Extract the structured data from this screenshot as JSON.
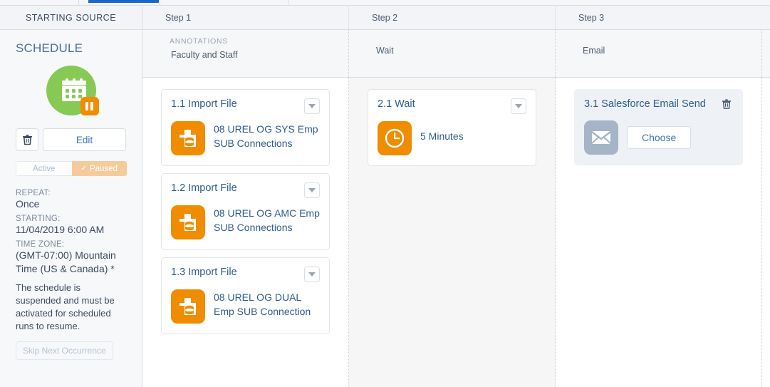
{
  "tabs": {
    "active_tab_indicator": "active"
  },
  "sidebar": {
    "header_title": "STARTING SOURCE",
    "schedule_title": "SCHEDULE",
    "icon": {
      "name": "calendar-icon",
      "badge": "pause-badge",
      "circle_color": "#86ca55",
      "badge_color": "#ef8c00"
    },
    "delete_label": "delete",
    "edit_label": "Edit",
    "toggle": {
      "inactive_label": "Active",
      "active_label": "Paused",
      "check": "✓",
      "active_color": "#f6cb9c"
    },
    "meta": [
      {
        "label": "REPEAT:",
        "value": "Once"
      },
      {
        "label": "STARTING:",
        "value": "11/04/2019 6:00 AM"
      },
      {
        "label": "TIME ZONE:",
        "value": "(GMT-07:00) Mountain Time (US & Canada) *"
      }
    ],
    "notice": "The schedule is suspended and must be activated for scheduled runs to resume.",
    "skip_label": "Skip Next Occurrence"
  },
  "steps": {
    "headers": [
      "Step 1",
      "Step 2",
      "Step 3"
    ],
    "annotations": {
      "title": "ANNOTATIONS",
      "step1_text": "Faculty and Staff",
      "step2_text": "Wait",
      "step3_text": "Email"
    },
    "columns": [
      {
        "cards": [
          {
            "title": "1.1 Import File",
            "subtitle": "08 UREL OG SYS Emp SUB Connections",
            "icon": "import-file-icon",
            "menu": "chevron-down-icon"
          },
          {
            "title": "1.2 Import File",
            "subtitle": "08 UREL OG AMC Emp SUB Connections",
            "icon": "import-file-icon",
            "menu": "chevron-down-icon"
          },
          {
            "title": "1.3 Import File",
            "subtitle": "08 UREL OG DUAL Emp SUB Connection",
            "icon": "import-file-icon",
            "menu": "chevron-down-icon"
          }
        ]
      },
      {
        "cards": [
          {
            "title": "2.1 Wait",
            "subtitle": "5 Minutes",
            "icon": "clock-icon",
            "menu": "chevron-down-icon"
          }
        ]
      },
      {
        "cards": [
          {
            "title": "3.1 Salesforce Email Send",
            "subtitle": "",
            "icon": "envelope-icon",
            "menu": "trash-icon",
            "button_label": "Choose"
          }
        ]
      }
    ]
  }
}
